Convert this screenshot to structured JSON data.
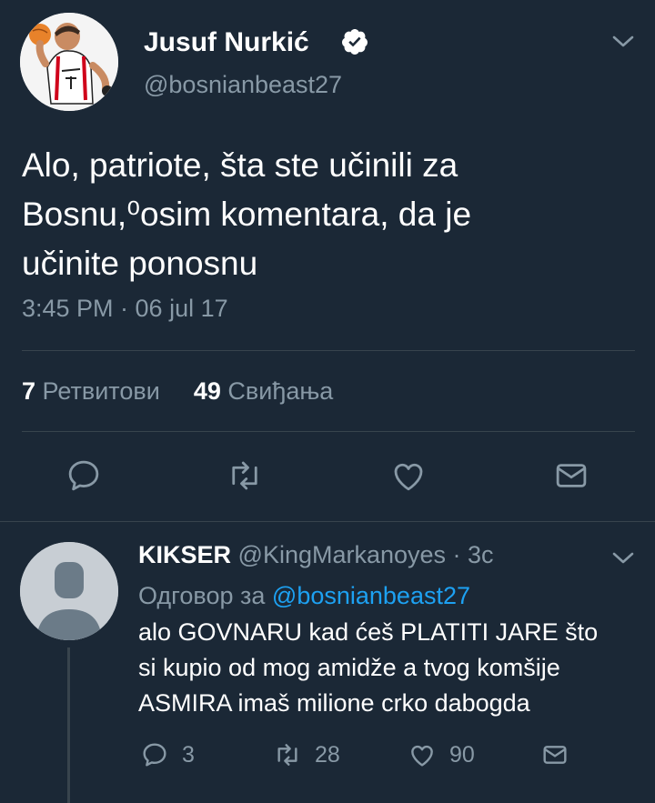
{
  "tweet": {
    "author_name": "Jusuf Nurkić",
    "handle": "@bosnianbeast27",
    "text": "Alo, patriote, šta ste učinili za\nBosnu,⁰osim komentara, da je\nučinite ponosnu",
    "timestamp": "3:45 PM · 06 jul 17",
    "retweets_count": "7",
    "retweets_label": "Ретвитови",
    "likes_count": "49",
    "likes_label": "Свиђања",
    "verified": true
  },
  "reply": {
    "author_name": "KIKSER",
    "handle_time": "@KingMarkanoyes · 3с",
    "replying_to_label": "Одговор за",
    "replying_to_mention": "@bosnianbeast27",
    "text": "alo GOVNARU kad ćeš PLATITI JARE što\nsi kupio od mog amidže a tvog komšije\nASMIRA imaš milione crko dabogda",
    "reply_count": "3",
    "retweet_count": "28",
    "like_count": "90"
  },
  "colors": {
    "background": "#1b2836",
    "secondary_text": "#8899a6",
    "divider": "#38444d",
    "accent": "#1da1f2"
  },
  "icons": [
    "verified-badge-icon",
    "chevron-down-icon",
    "reply-icon",
    "retweet-icon",
    "like-icon",
    "message-icon"
  ]
}
